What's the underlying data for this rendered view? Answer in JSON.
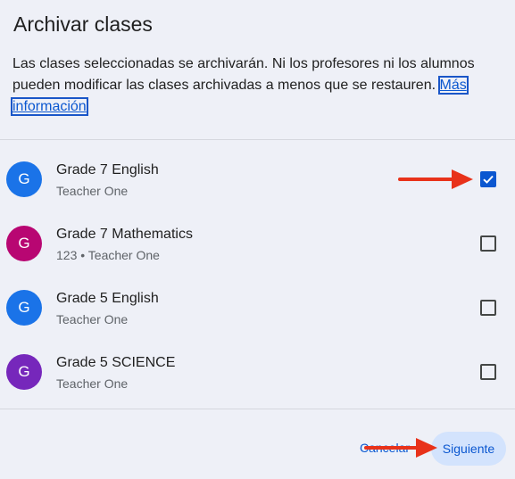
{
  "dialog": {
    "title": "Archivar clases",
    "description": "Las clases seleccionadas se archivarán. Ni los profesores ni los alumnos pueden modificar las clases archivadas a menos que se restauren.",
    "more_link": "Más información"
  },
  "classes": [
    {
      "initial": "G",
      "name": "Grade 7 English",
      "subtitle": "Teacher One",
      "checked": true,
      "avatar_color": "#1a73e8"
    },
    {
      "initial": "G",
      "name": "Grade 7 Mathematics",
      "subtitle": "123 • Teacher One",
      "checked": false,
      "avatar_color": "#b80672"
    },
    {
      "initial": "G",
      "name": "Grade 5 English",
      "subtitle": "Teacher One",
      "checked": false,
      "avatar_color": "#1a73e8"
    },
    {
      "initial": "G",
      "name": "Grade 5 SCIENCE",
      "subtitle": "Teacher One",
      "checked": false,
      "avatar_color": "#7627bb"
    }
  ],
  "footer": {
    "cancel_label": "Cancelar",
    "next_label": "Siguiente"
  },
  "colors": {
    "accent": "#0b57d0",
    "arrow": "#e8321a",
    "background": "#eef0f7"
  }
}
